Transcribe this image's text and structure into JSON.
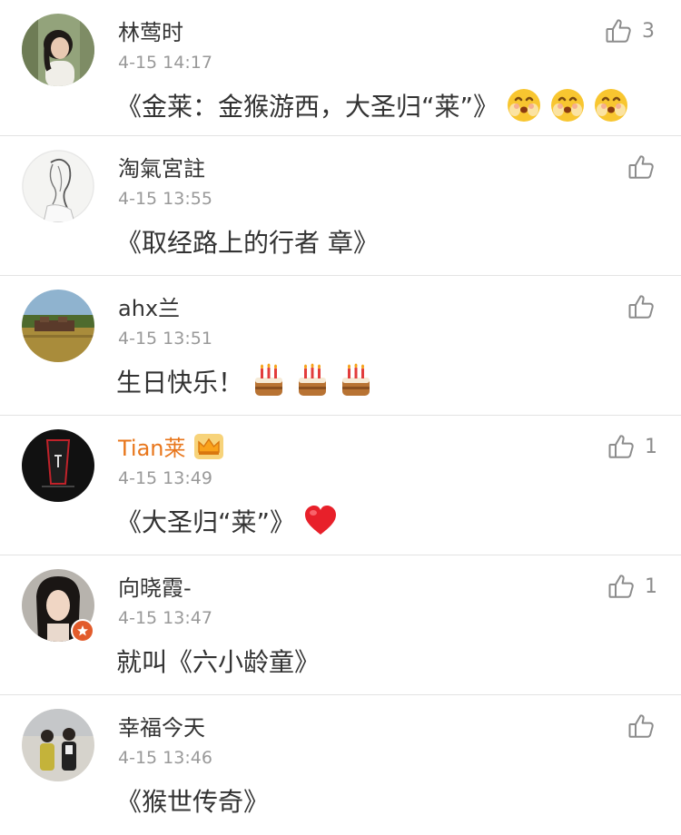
{
  "comments": [
    {
      "name": "林莺时",
      "time": "4-15 14:17",
      "text": "《金莱：金猴游西，大圣归“莱”》",
      "likes": "3",
      "emojis": [
        "blush-face",
        "blush-face",
        "blush-face"
      ]
    },
    {
      "name": "淘氣宮註",
      "time": "4-15 13:55",
      "text": "《取经路上的行者 章》",
      "likes": "",
      "emojis": []
    },
    {
      "name": "ahx兰",
      "time": "4-15 13:51",
      "text": "生日快乐！",
      "likes": "",
      "emojis": [
        "birthday-cake",
        "birthday-cake",
        "birthday-cake"
      ]
    },
    {
      "name": "Tian莱",
      "time": "4-15 13:49",
      "text": "《大圣归“莱”》",
      "likes": "1",
      "emojis": [
        "red-heart"
      ],
      "vip": true
    },
    {
      "name": "向晓霞-",
      "time": "4-15 13:47",
      "text": "就叫《六小龄童》",
      "likes": "1",
      "emojis": []
    },
    {
      "name": "幸福今天",
      "time": "4-15 13:46",
      "text": "《猴世传奇》",
      "likes": "",
      "emojis": []
    }
  ],
  "colors": {
    "vip_name": "#e8761b",
    "text": "#333333",
    "meta": "#999999",
    "divider": "#e3e3e3"
  }
}
